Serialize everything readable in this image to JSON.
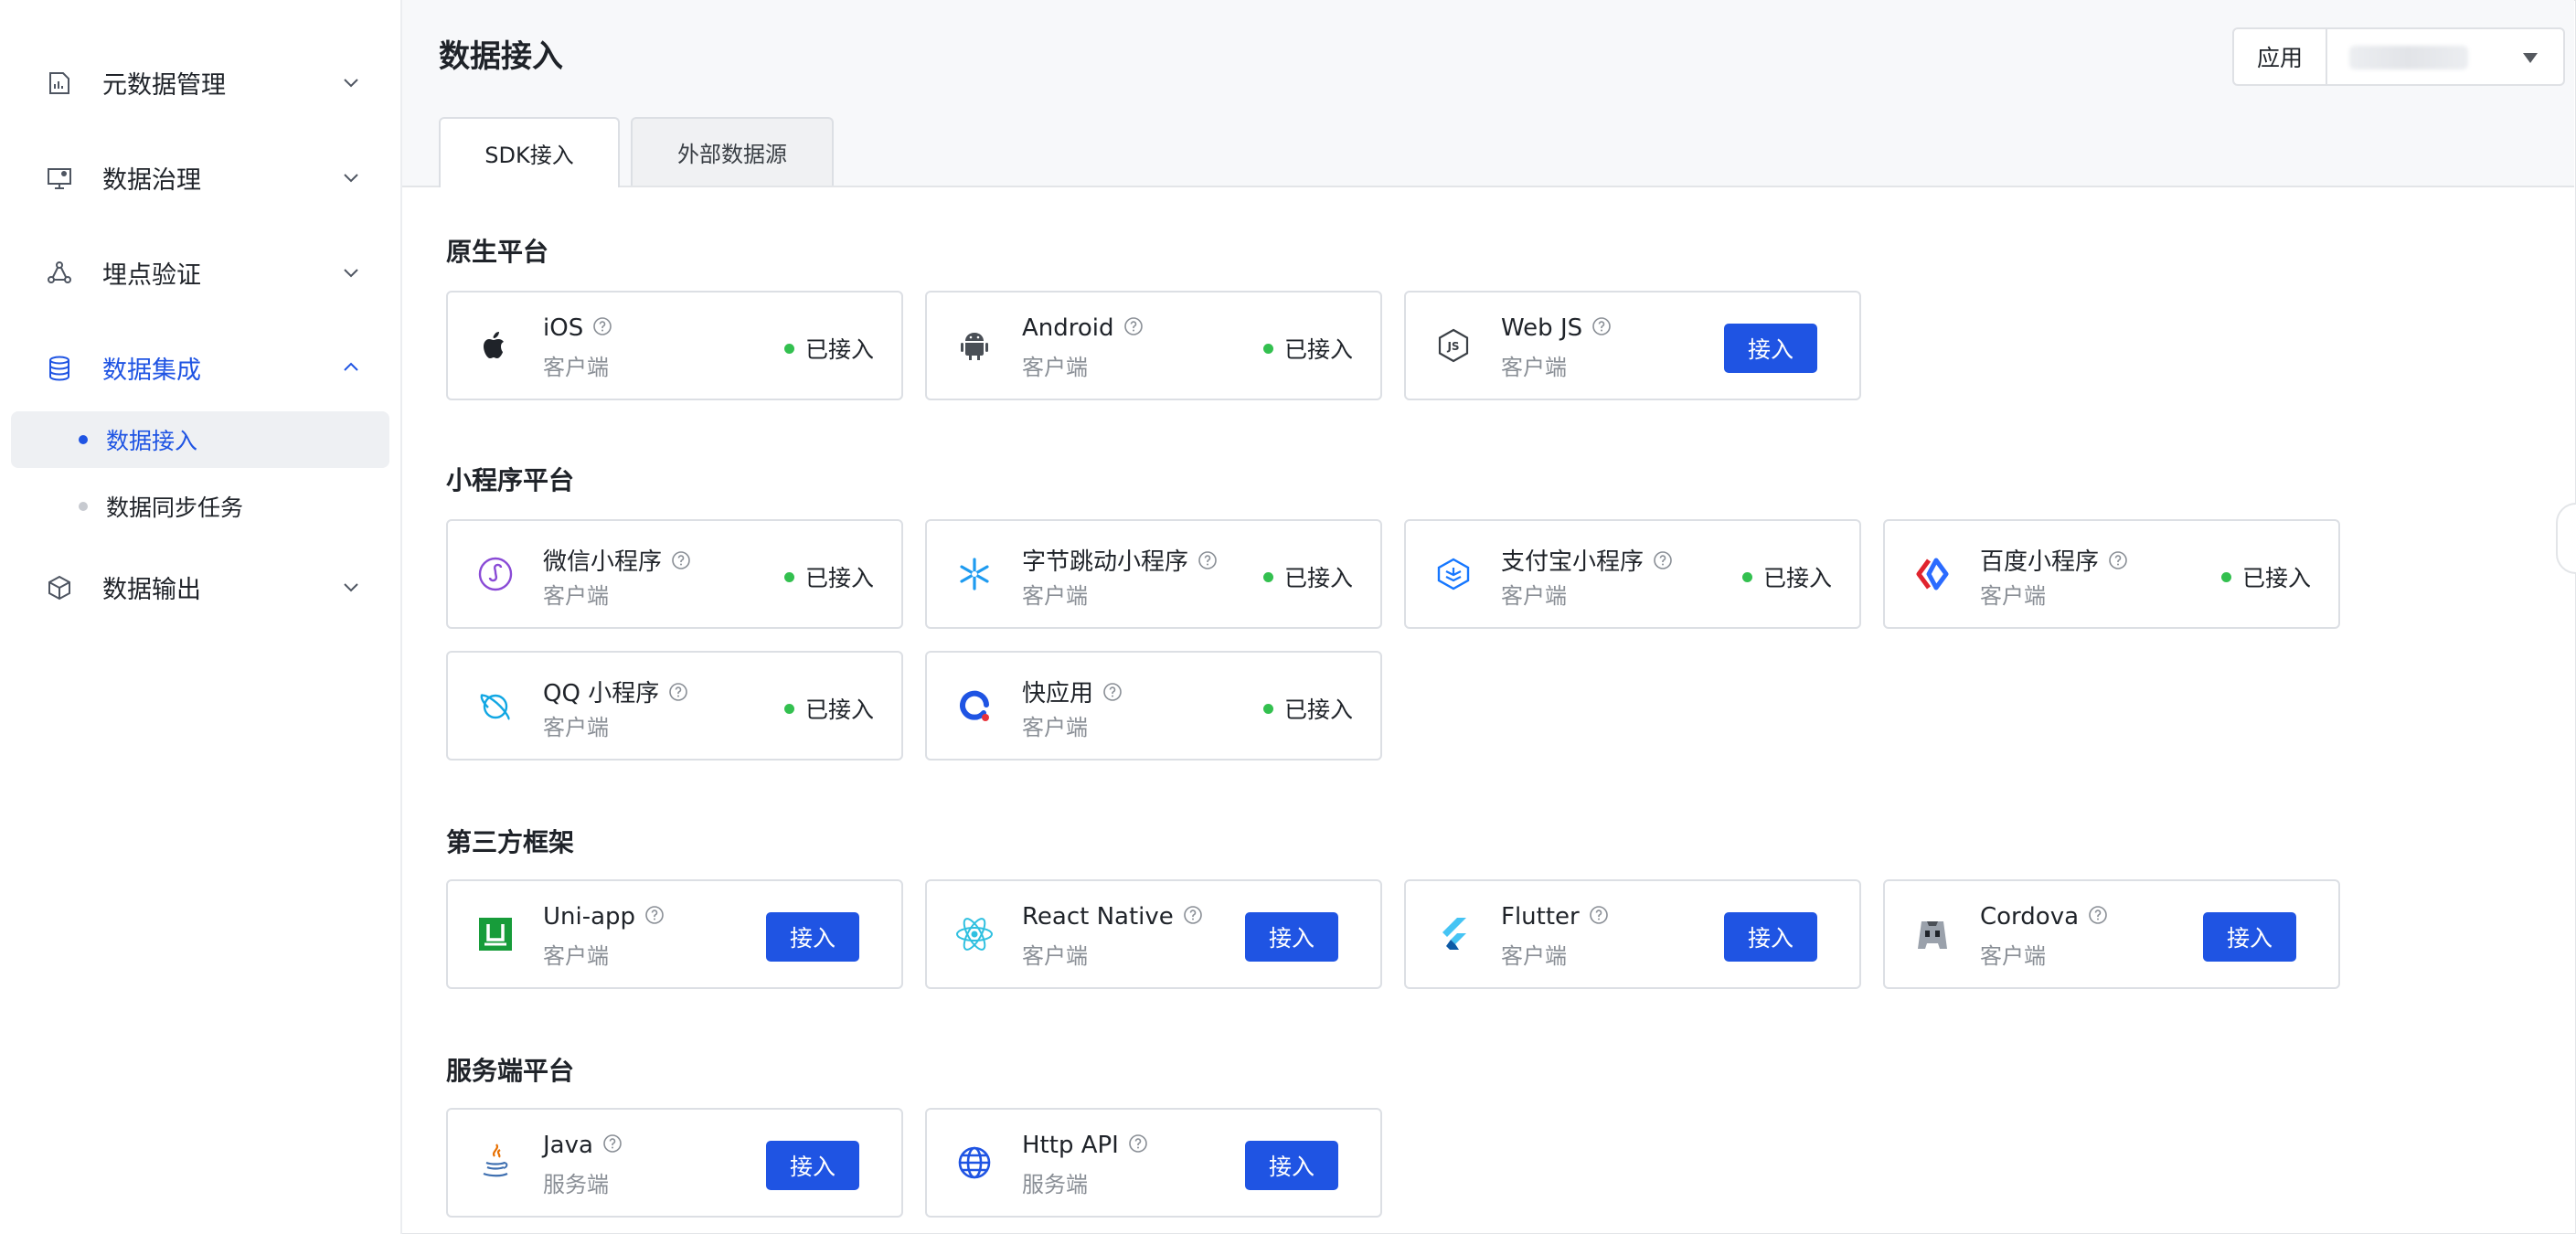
{
  "sidebar": {
    "items": [
      {
        "label": "元数据管理",
        "icon": "chart-doc-icon"
      },
      {
        "label": "数据治理",
        "icon": "monitor-gear-icon"
      },
      {
        "label": "埋点验证",
        "icon": "nodes-icon"
      },
      {
        "label": "数据集成",
        "icon": "database-icon",
        "expanded": true
      },
      {
        "label": "数据输出",
        "icon": "cube-icon"
      }
    ],
    "subitems": [
      {
        "label": "数据接入",
        "selected": true
      },
      {
        "label": "数据同步任务",
        "selected": false
      }
    ]
  },
  "header": {
    "title": "数据接入",
    "app_select": {
      "label": "应用",
      "value": ""
    },
    "tabs": [
      {
        "label": "SDK接入",
        "active": true
      },
      {
        "label": "外部数据源",
        "active": false
      }
    ]
  },
  "sections": [
    {
      "title": "原生平台",
      "cards": [
        {
          "name": "iOS",
          "sub": "客户端",
          "status": "已接入",
          "icon": "apple-icon"
        },
        {
          "name": "Android",
          "sub": "客户端",
          "status": "已接入",
          "icon": "android-icon"
        },
        {
          "name": "Web JS",
          "sub": "客户端",
          "action": "接入",
          "icon": "nodejs-icon"
        }
      ]
    },
    {
      "title": "小程序平台",
      "cards": [
        {
          "name": "微信小程序",
          "sub": "客户端",
          "status": "已接入",
          "icon": "wechat-miniprogram-icon"
        },
        {
          "name": "字节跳动小程序",
          "sub": "客户端",
          "status": "已接入",
          "icon": "bytedance-miniprogram-icon"
        },
        {
          "name": "支付宝小程序",
          "sub": "客户端",
          "status": "已接入",
          "icon": "alipay-miniprogram-icon"
        },
        {
          "name": "百度小程序",
          "sub": "客户端",
          "status": "已接入",
          "icon": "baidu-miniprogram-icon"
        },
        {
          "name": "QQ 小程序",
          "sub": "客户端",
          "status": "已接入",
          "icon": "qq-miniprogram-icon"
        },
        {
          "name": "快应用",
          "sub": "客户端",
          "status": "已接入",
          "icon": "quickapp-icon"
        }
      ]
    },
    {
      "title": "第三方框架",
      "cards": [
        {
          "name": "Uni-app",
          "sub": "客户端",
          "action": "接入",
          "icon": "uniapp-icon"
        },
        {
          "name": "React Native",
          "sub": "客户端",
          "action": "接入",
          "icon": "react-icon"
        },
        {
          "name": "Flutter",
          "sub": "客户端",
          "action": "接入",
          "icon": "flutter-icon"
        },
        {
          "name": "Cordova",
          "sub": "客户端",
          "action": "接入",
          "icon": "cordova-icon"
        }
      ]
    },
    {
      "title": "服务端平台",
      "cards": [
        {
          "name": "Java",
          "sub": "服务端",
          "action": "接入",
          "icon": "java-icon"
        },
        {
          "name": "Http API",
          "sub": "服务端",
          "action": "接入",
          "icon": "globe-icon"
        }
      ]
    }
  ],
  "colors": {
    "accent": "#1f54e3",
    "status_ok": "#33c04f",
    "muted": "#8a8f96"
  }
}
